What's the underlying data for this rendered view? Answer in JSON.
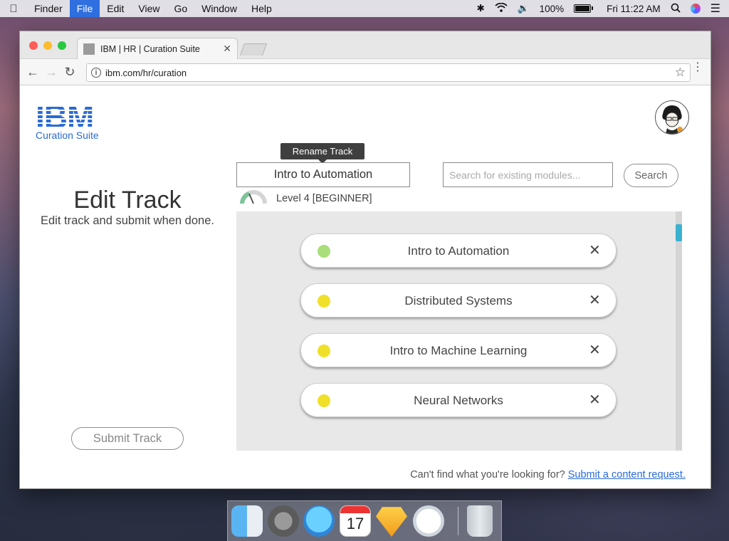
{
  "menubar": {
    "items": [
      "Finder",
      "File",
      "Edit",
      "View",
      "Go",
      "Window",
      "Help"
    ],
    "active_item": "File",
    "battery": "100%",
    "clock": "Fri 11:22 AM"
  },
  "browser": {
    "tab_title": "IBM | HR | Curation Suite",
    "url": "ibm.com/hr/curation"
  },
  "brand": {
    "logo_text": "IBM",
    "suite_label": "Curation Suite",
    "color": "#2a6bd6"
  },
  "sidebar": {
    "title": "Edit Track",
    "subtitle": "Edit track and submit when done.",
    "submit_label": "Submit Track"
  },
  "track": {
    "tooltip": "Rename Track",
    "name": "Intro to Automation",
    "level_text": "Level 4 [BEGINNER]"
  },
  "search": {
    "placeholder": "Search for existing modules...",
    "button_label": "Search"
  },
  "modules": [
    {
      "title": "Intro to Automation",
      "status_color": "#a9de7a"
    },
    {
      "title": "Distributed Systems",
      "status_color": "#f0e02a"
    },
    {
      "title": "Intro to Machine Learning",
      "status_color": "#f0e02a"
    },
    {
      "title": "Neural Networks",
      "status_color": "#f0e02a"
    }
  ],
  "footer": {
    "prompt": "Can't find what you're looking for?",
    "link": "Submit a content request."
  },
  "dock": {
    "calendar_day": "17"
  }
}
